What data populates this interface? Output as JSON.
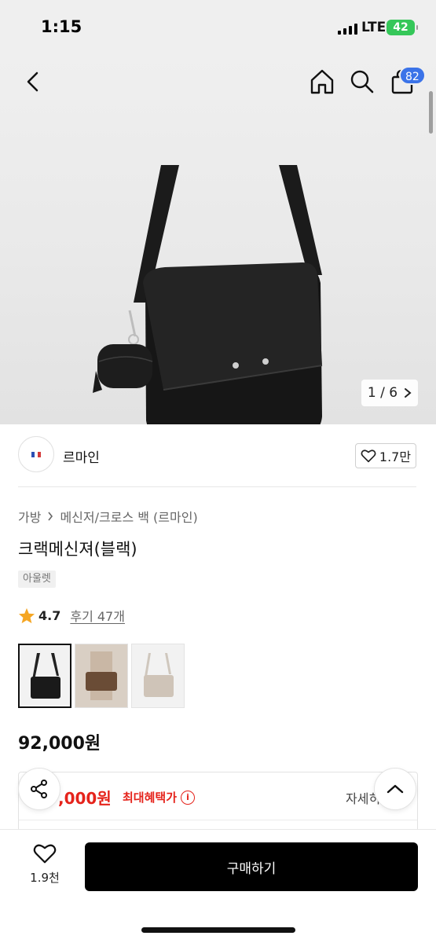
{
  "status": {
    "time": "1:15",
    "network": "LTE",
    "battery": "42"
  },
  "header": {
    "cart_count": "82",
    "icons": [
      "back-arrow-icon",
      "home-icon",
      "search-icon",
      "shopping-bag-icon"
    ]
  },
  "gallery": {
    "counter": "1 / 6",
    "current": 1,
    "total": 6
  },
  "brand": {
    "name": "르마인",
    "likes": "1.7만",
    "logo_colors": [
      "#2c4fb3",
      "#ffffff",
      "#d43a3a"
    ]
  },
  "product": {
    "breadcrumb": [
      "가방",
      "메신저/크로스 백 (르마인)"
    ],
    "title": "크랙메신져(블랙)",
    "badge": "아울렛",
    "rating": "4.7",
    "reviews": "후기 47개",
    "colors": [
      "black",
      "brown",
      "beige"
    ],
    "price": "92,000원"
  },
  "benefit": {
    "price_fragment": ",000원",
    "label": "최대혜택가",
    "detail": "자세히"
  },
  "bottom": {
    "wish_count": "1.9천",
    "buy_label": "구매하기"
  },
  "colors": {
    "accent_red": "#e5231b",
    "badge_blue": "#3b73e8",
    "star": "#f5a623",
    "primary_button": "#000000"
  }
}
